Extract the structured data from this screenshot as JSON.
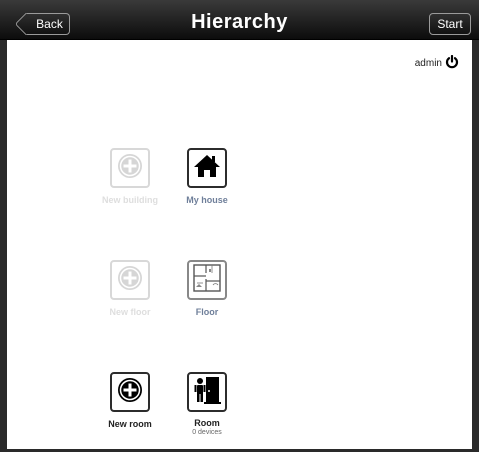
{
  "header": {
    "title": "Hierarchy",
    "back_label": "Back",
    "start_label": "Start"
  },
  "user": {
    "name": "admin",
    "icon": "power-icon"
  },
  "tiles": [
    {
      "label": "New building",
      "icon": "add-circle-icon",
      "enabled": false
    },
    {
      "label": "My house",
      "icon": "house-icon",
      "enabled": true
    },
    {
      "label": "New floor",
      "icon": "add-circle-icon",
      "enabled": false
    },
    {
      "label": "Floor",
      "icon": "floor-plan-icon",
      "enabled": true
    },
    {
      "label": "New room",
      "icon": "add-circle-icon",
      "enabled": true
    },
    {
      "label": "Room",
      "sublabel": "0 devices",
      "icon": "door-person-icon",
      "enabled": true
    }
  ],
  "colors": {
    "header": "#1a1a1a",
    "label_link": "#6f7f9a",
    "disabled": "#dedede"
  }
}
